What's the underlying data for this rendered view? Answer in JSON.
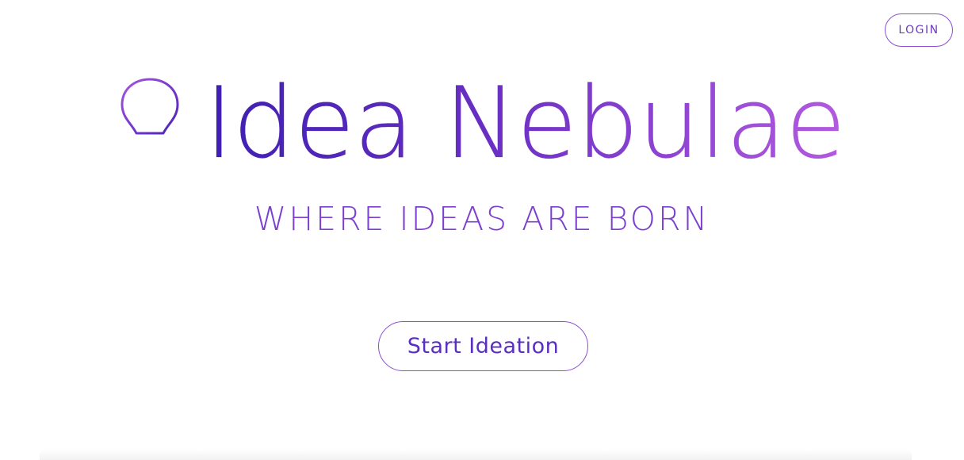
{
  "header": {
    "login_label": "LOGIN"
  },
  "hero": {
    "title": "Idea Nebulae",
    "tagline": "WHERE IDEAS ARE BORN",
    "cta_label": "Start Ideation",
    "logo_icon": "lightbulb-icon"
  },
  "colors": {
    "accent_dark": "#3d1fb0",
    "accent_mid": "#6a2fc4",
    "accent_light": "#b35ae0",
    "button_border": "#8b4fd0"
  }
}
